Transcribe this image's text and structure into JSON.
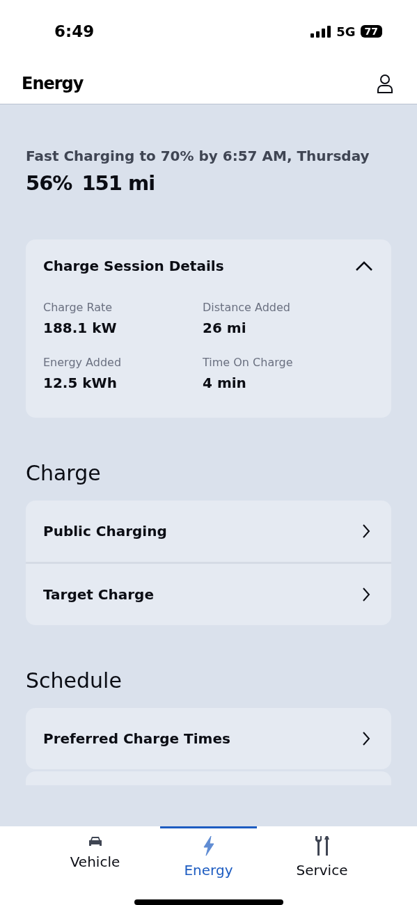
{
  "status_bar": {
    "time": "6:49",
    "network": "5G",
    "battery": "77"
  },
  "header": {
    "title": "Energy"
  },
  "charge_status": {
    "message": "Fast Charging to 70% by 6:57 AM, Thursday",
    "percent": "56%",
    "range": "151 mi"
  },
  "session": {
    "title": "Charge Session Details",
    "expanded": true,
    "details": [
      {
        "label": "Charge Rate",
        "value": "188.1 kW"
      },
      {
        "label": "Distance Added",
        "value": "26 mi"
      },
      {
        "label": "Energy Added",
        "value": "12.5 kWh"
      },
      {
        "label": "Time On Charge",
        "value": "4 min"
      }
    ]
  },
  "sections": [
    {
      "title": "Charge",
      "items": [
        "Public Charging",
        "Target Charge"
      ]
    },
    {
      "title": "Schedule",
      "items": [
        "Preferred Charge Times"
      ]
    }
  ],
  "tab_bar": [
    {
      "label": "Vehicle",
      "kind": "car",
      "selected": false
    },
    {
      "label": "Energy",
      "kind": "bolt",
      "selected": true
    },
    {
      "label": "Service",
      "kind": "tools",
      "selected": false
    }
  ]
}
